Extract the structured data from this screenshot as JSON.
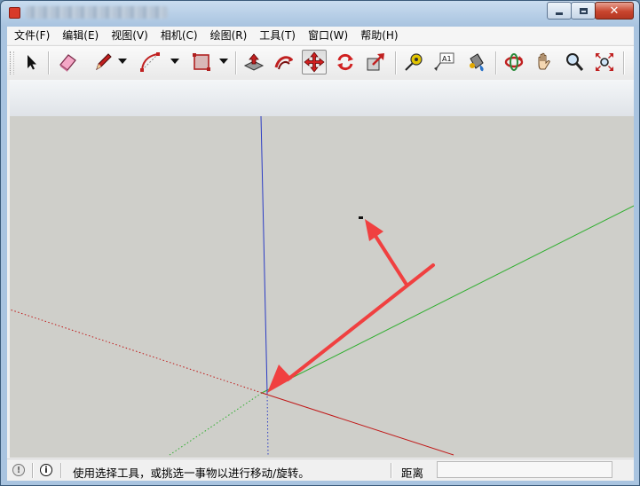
{
  "window": {
    "controls": {
      "minimize": "minimize",
      "maximize": "maximize",
      "close": "close"
    }
  },
  "menu": [
    {
      "label": "文件(F)"
    },
    {
      "label": "编辑(E)"
    },
    {
      "label": "视图(V)"
    },
    {
      "label": "相机(C)"
    },
    {
      "label": "绘图(R)"
    },
    {
      "label": "工具(T)"
    },
    {
      "label": "窗口(W)"
    },
    {
      "label": "帮助(H)"
    }
  ],
  "toolbar": {
    "tools": [
      {
        "name": "select-tool",
        "icon": "arrow-cursor-icon"
      },
      {
        "name": "eraser-tool",
        "icon": "eraser-icon"
      },
      {
        "name": "pencil-tool",
        "icon": "pencil-icon"
      },
      {
        "name": "arc-tool",
        "icon": "arc-icon"
      },
      {
        "name": "shape-tool",
        "icon": "rectangle-icon"
      },
      {
        "name": "push-pull-tool",
        "icon": "push-pull-icon"
      },
      {
        "name": "follow-me-tool",
        "icon": "follow-me-icon"
      },
      {
        "name": "move-tool",
        "icon": "move-arrows-icon",
        "active": true
      },
      {
        "name": "rotate-tool",
        "icon": "rotate-icon"
      },
      {
        "name": "scale-tool",
        "icon": "scale-icon"
      },
      {
        "name": "tape-measure-tool",
        "icon": "tape-measure-icon"
      },
      {
        "name": "text-tool",
        "icon": "text-label-icon",
        "text": "A1"
      },
      {
        "name": "paint-bucket-tool",
        "icon": "paint-bucket-icon"
      },
      {
        "name": "orbit-tool",
        "icon": "orbit-icon"
      },
      {
        "name": "pan-tool",
        "icon": "hand-icon"
      },
      {
        "name": "zoom-tool",
        "icon": "magnifier-icon"
      },
      {
        "name": "zoom-extents-tool",
        "icon": "zoom-extents-icon"
      }
    ]
  },
  "colors": {
    "axis_blue": "#2b3cc4",
    "axis_green": "#2fae2f",
    "axis_red": "#c01818",
    "annotation_arrow": "#f04040",
    "viewport_ground": "#cfcfca"
  },
  "status": {
    "hint_icon": "hint-icon",
    "info_icon": "info-icon",
    "text": "使用选择工具，或挑选一事物以进行移动/旋转。",
    "distance_label": "距离",
    "distance_value": ""
  }
}
